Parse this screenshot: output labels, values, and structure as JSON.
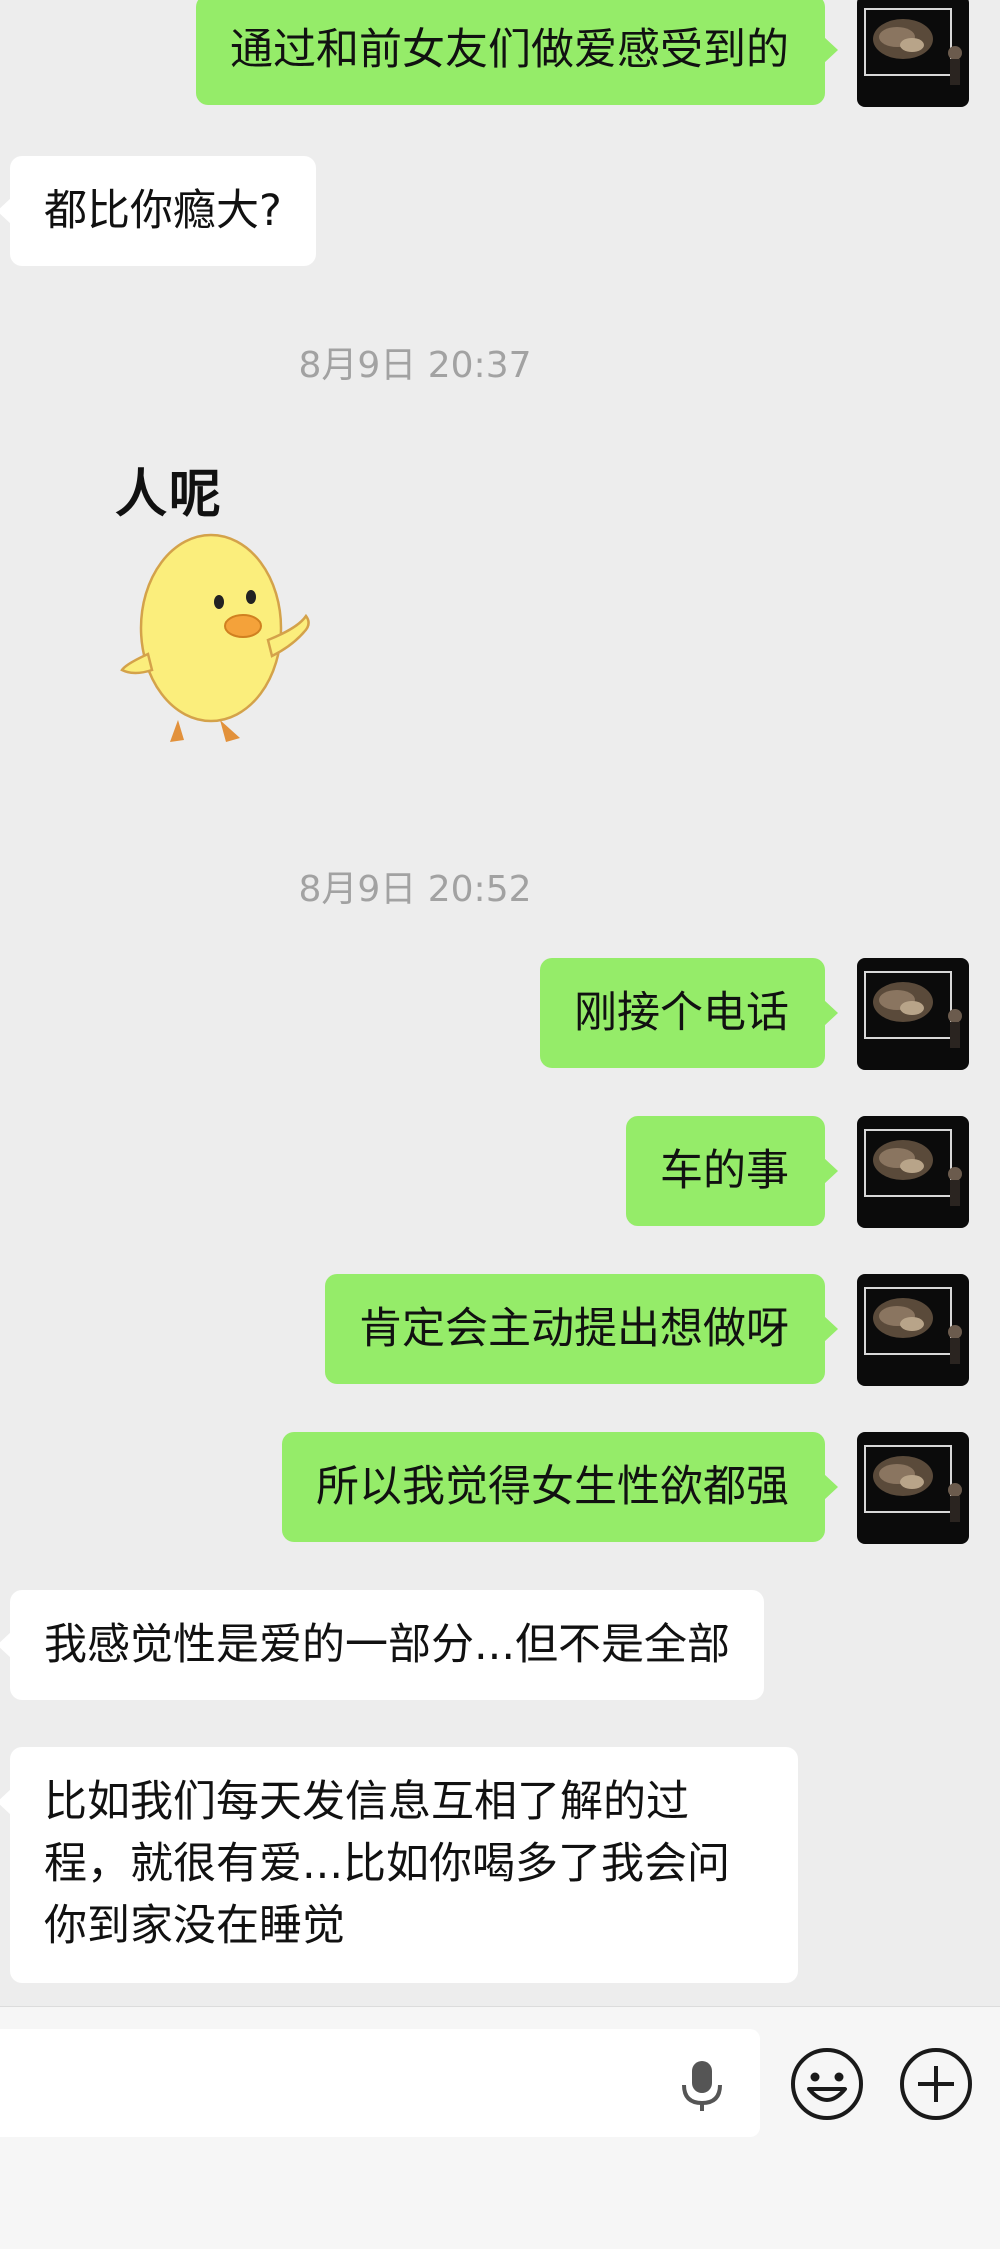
{
  "conversation": {
    "messages_top": [
      {
        "side": "out",
        "text": "通过和前女友们做爱感受到的"
      },
      {
        "side": "in",
        "text": "都比你瘾大?"
      }
    ],
    "timestamp_1": "8月9日 20:37",
    "sticker": {
      "caption": "人呢",
      "icon": "duck-sticker-icon"
    },
    "timestamp_2": "8月9日 20:52",
    "messages_bottom": [
      {
        "side": "out",
        "text": "刚接个电话"
      },
      {
        "side": "out",
        "text": "车的事"
      },
      {
        "side": "out",
        "text": "肯定会主动提出想做呀"
      },
      {
        "side": "out",
        "text": "所以我觉得女生性欲都强"
      },
      {
        "side": "in",
        "text": "我感觉性是爱的一部分...但不是全部"
      },
      {
        "side": "in",
        "text": "比如我们每天发信息互相了解的过程，就很有爱...比如你喝多了我会问你到家没在睡觉"
      }
    ]
  },
  "composer": {
    "input_value": "",
    "icons": [
      "microphone-icon",
      "emoji-icon",
      "plus-icon"
    ]
  },
  "colors": {
    "background": "#ededed",
    "outgoing_bubble": "#95ec69",
    "incoming_bubble": "#ffffff",
    "timestamp_text": "#a2a2a2"
  }
}
